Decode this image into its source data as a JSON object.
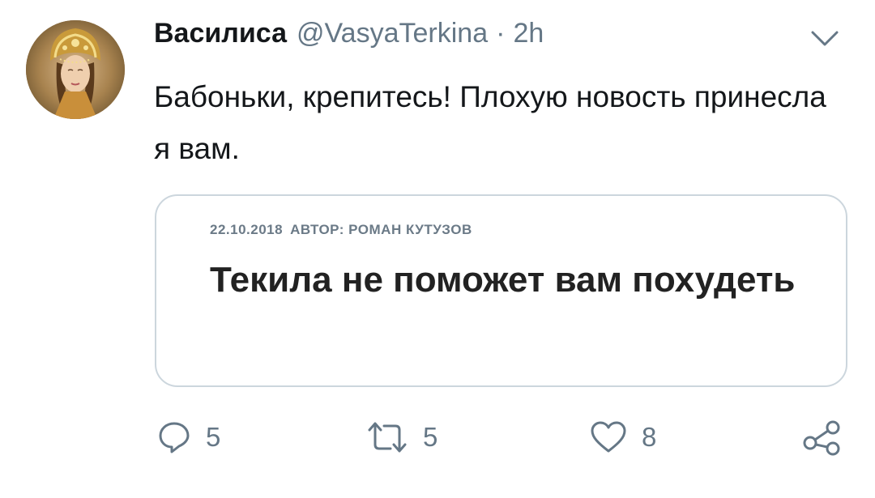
{
  "tweet": {
    "author": {
      "name": "Василиса",
      "handle": "@VasyaTerkina",
      "separator": "·",
      "time": "2h"
    },
    "text": "Бабоньки, крепитесь! Плохую новость принесла я вам.",
    "card": {
      "date": "22.10.2018",
      "author_label": "АВТОР: РОМАН КУТУЗОВ",
      "title": "Текила не поможет вам похудеть"
    },
    "actions": {
      "replies": "5",
      "retweets": "5",
      "likes": "8"
    },
    "icons": {
      "reply": "reply-icon",
      "retweet": "retweet-icon",
      "like": "heart-icon",
      "share": "share-icon",
      "menu": "chevron-down-icon"
    },
    "colors": {
      "text": "#14171a",
      "secondary": "#657786",
      "border": "#ccd6dd"
    }
  }
}
